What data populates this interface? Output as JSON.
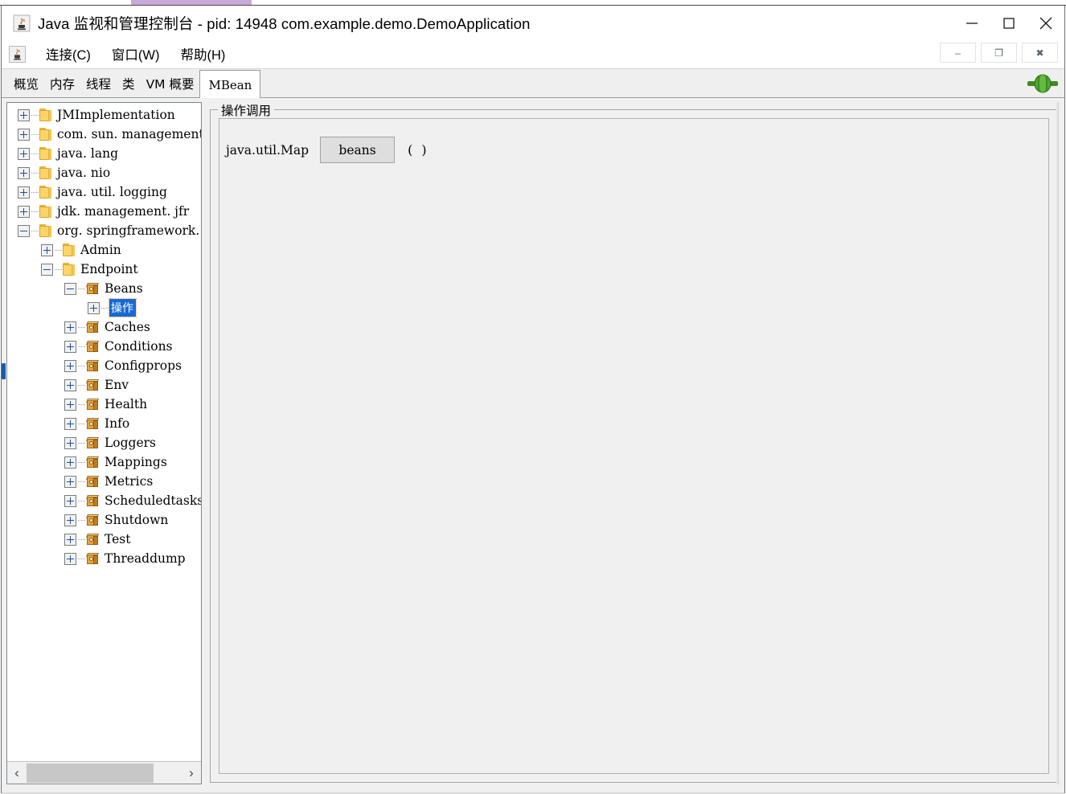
{
  "window": {
    "title": "Java 监视和管理控制台 - pid: 14948 com.example.demo.DemoApplication",
    "icon": "java-cup-icon",
    "controls": {
      "minimize": "minimize-icon",
      "maximize": "maximize-icon",
      "close": "close-icon"
    },
    "mdi_controls": {
      "minimize": "–",
      "restore": "❐",
      "close": "✖"
    }
  },
  "menubar": {
    "app_icon": "java-cup-icon",
    "items": [
      {
        "label": "连接(C)"
      },
      {
        "label": "窗口(W)"
      },
      {
        "label": "帮助(H)"
      }
    ]
  },
  "tabs": {
    "items": [
      {
        "label": "概览",
        "active": false
      },
      {
        "label": "内存",
        "active": false
      },
      {
        "label": "线程",
        "active": false
      },
      {
        "label": "类",
        "active": false
      },
      {
        "label": "VM 概要",
        "active": false
      },
      {
        "label": "MBean",
        "active": true
      }
    ],
    "connection_icon": "green-plug-connected-icon"
  },
  "tree": {
    "nodes": [
      {
        "label": "JMImplementation",
        "depth": 0,
        "icon": "folder-icon",
        "state": "plus"
      },
      {
        "label": "com. sun. management",
        "depth": 0,
        "icon": "folder-icon",
        "state": "plus"
      },
      {
        "label": "java. lang",
        "depth": 0,
        "icon": "folder-icon",
        "state": "plus"
      },
      {
        "label": "java. nio",
        "depth": 0,
        "icon": "folder-icon",
        "state": "plus"
      },
      {
        "label": "java. util. logging",
        "depth": 0,
        "icon": "folder-icon",
        "state": "plus"
      },
      {
        "label": "jdk. management. jfr",
        "depth": 0,
        "icon": "folder-icon",
        "state": "plus"
      },
      {
        "label": "org. springframework.",
        "depth": 0,
        "icon": "folder-icon",
        "state": "minus"
      },
      {
        "label": "Admin",
        "depth": 1,
        "icon": "folder-icon",
        "state": "plus"
      },
      {
        "label": "Endpoint",
        "depth": 1,
        "icon": "folder-icon",
        "state": "minus"
      },
      {
        "label": "Beans",
        "depth": 2,
        "icon": "mbean-icon",
        "state": "minus"
      },
      {
        "label": "操作",
        "depth": 3,
        "icon": "none",
        "state": "plus",
        "selected": true
      },
      {
        "label": "Caches",
        "depth": 2,
        "icon": "mbean-icon",
        "state": "plus"
      },
      {
        "label": "Conditions",
        "depth": 2,
        "icon": "mbean-icon",
        "state": "plus"
      },
      {
        "label": "Configprops",
        "depth": 2,
        "icon": "mbean-icon",
        "state": "plus"
      },
      {
        "label": "Env",
        "depth": 2,
        "icon": "mbean-icon",
        "state": "plus"
      },
      {
        "label": "Health",
        "depth": 2,
        "icon": "mbean-icon",
        "state": "plus"
      },
      {
        "label": "Info",
        "depth": 2,
        "icon": "mbean-icon",
        "state": "plus"
      },
      {
        "label": "Loggers",
        "depth": 2,
        "icon": "mbean-icon",
        "state": "plus"
      },
      {
        "label": "Mappings",
        "depth": 2,
        "icon": "mbean-icon",
        "state": "plus"
      },
      {
        "label": "Metrics",
        "depth": 2,
        "icon": "mbean-icon",
        "state": "plus"
      },
      {
        "label": "Scheduledtasks",
        "depth": 2,
        "icon": "mbean-icon",
        "state": "plus"
      },
      {
        "label": "Shutdown",
        "depth": 2,
        "icon": "mbean-icon",
        "state": "plus"
      },
      {
        "label": "Test",
        "depth": 2,
        "icon": "mbean-icon",
        "state": "plus"
      },
      {
        "label": "Threaddump",
        "depth": 2,
        "icon": "mbean-icon",
        "state": "plus"
      }
    ],
    "hscrollbar": {
      "left_arrow": "‹",
      "right_arrow": "›"
    }
  },
  "main": {
    "group_title": "操作调用",
    "operation": {
      "return_type": "java.util.Map",
      "button_label": "beans",
      "parameters": "( )"
    }
  },
  "colors": {
    "accent_top_strip": "#c9a8dd",
    "selection_blue": "#1669d6",
    "folder_yellow": "#fdd46a",
    "mbean_orange": "#e8a33c",
    "panel_gray": "#f0f0f0",
    "connected_green": "#3f9a28"
  }
}
